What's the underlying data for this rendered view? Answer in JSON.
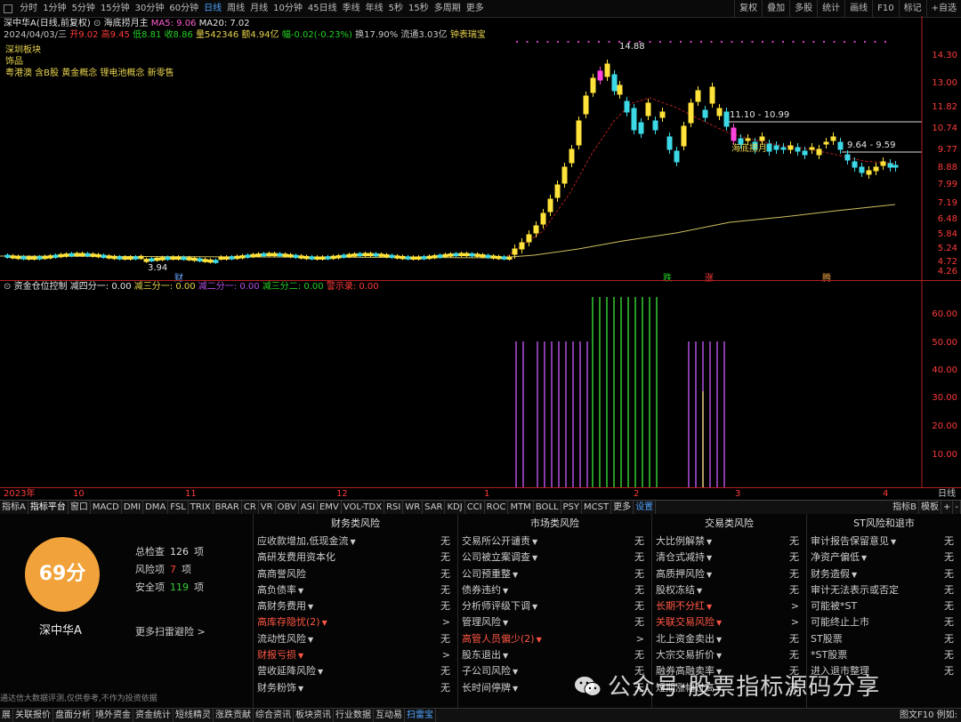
{
  "period_bar": {
    "items": [
      "分时",
      "1分钟",
      "5分钟",
      "15分钟",
      "30分钟",
      "60分钟",
      "日线",
      "周线",
      "月线",
      "10分钟",
      "45日线",
      "季线",
      "年线",
      "5秒",
      "15秒",
      "多周期",
      "更多"
    ],
    "active": "日线",
    "right_tools": [
      "复权",
      "叠加",
      "多股",
      "统计",
      "画线",
      "F10",
      "标记",
      "+自选"
    ]
  },
  "info_line": {
    "stock": "深中华A(日线,前复权)",
    "indicator": "海底捞月主",
    "ma5": "MA5: 9.06",
    "ma20": "MA20: 7.02"
  },
  "ohlc_line": {
    "date": "2024/04/03/三",
    "open": "开9.02",
    "high": "高9.45",
    "low": "低8.81",
    "close": "收8.86",
    "volume": "量542346",
    "amount": "额4.94亿",
    "change": "幅-0.02(-0.23%)",
    "turnover": "换17.90%",
    "float_cap": "流通3.03亿",
    "tool": "钟表瑞宝"
  },
  "tags": [
    "深圳板块",
    "饰品",
    "粤港澳 含B股 黄金概念 锂电池概念 新零售"
  ],
  "price_axis": [
    "14.30",
    "13.00",
    "11.82",
    "10.74",
    "9.77",
    "8.88",
    "7.99",
    "7.19",
    "6.48",
    "5.84",
    "5.24",
    "4.72",
    "4.26"
  ],
  "chart_labels": {
    "peak": "14.88",
    "low": "3.94",
    "range1": "11.10 - 10.99",
    "range2": "9.64 - 9.59",
    "pattern": "海底捞月",
    "markers": [
      "财",
      "跌",
      "涨",
      "腾"
    ]
  },
  "indicator_header": {
    "name": "资金仓位控制",
    "values": [
      "减四分一: 0.00",
      "减三分一: 0.00",
      "减二分一: 0.00",
      "减三分二: 0.00",
      "警示录: 0.00"
    ]
  },
  "ind_axis": [
    "60.00",
    "50.00",
    "40.00",
    "30.00",
    "20.00",
    "10.00"
  ],
  "date_axis": {
    "ticks": [
      "2023年",
      "10",
      "11",
      "12",
      "1",
      "2",
      "3",
      "4"
    ],
    "period": "日线"
  },
  "indicator_tabs": {
    "items": [
      "指标A",
      "指标平台",
      "窗口",
      "MACD",
      "DMI",
      "DMA",
      "FSL",
      "TRIX",
      "BRAR",
      "CR",
      "VR",
      "OBV",
      "ASI",
      "EMV",
      "VOL-TDX",
      "RSI",
      "WR",
      "SAR",
      "KDJ",
      "CCI",
      "ROC",
      "MTM",
      "BOLL",
      "PSY",
      "MCST",
      "更多",
      "设置"
    ],
    "right": [
      "指标B",
      "模板",
      "+",
      "-"
    ]
  },
  "scan": {
    "score": "69分",
    "stock_name": "深中华A",
    "summary": [
      {
        "label": "总检查",
        "value": "126",
        "unit": "项",
        "color": "#dddddd"
      },
      {
        "label": "风险项",
        "value": "7",
        "unit": "项",
        "color": "#ff4433"
      },
      {
        "label": "安全项",
        "value": "119",
        "unit": "项",
        "color": "#33cc33"
      }
    ],
    "more": "更多扫雷避险 >",
    "disclaimer": "通达信大数据评测,仅供参考,不作为投资依据",
    "columns": [
      {
        "title": "财务类风险",
        "rows": [
          {
            "label": "应收款增加,低现金流",
            "dd": true,
            "val": "无",
            "warn": false
          },
          {
            "label": "高研发费用资本化",
            "dd": false,
            "val": "无",
            "warn": false
          },
          {
            "label": "高商誉风险",
            "dd": false,
            "val": "无",
            "warn": false
          },
          {
            "label": "高负债率",
            "dd": true,
            "val": "无",
            "warn": false
          },
          {
            "label": "高财务费用",
            "dd": true,
            "val": "无",
            "warn": false
          },
          {
            "label": "高库存隐忧(2)",
            "dd": true,
            "val": ">",
            "warn": true
          },
          {
            "label": "流动性风险",
            "dd": true,
            "val": "无",
            "warn": false
          },
          {
            "label": "财报亏损",
            "dd": true,
            "val": ">",
            "warn": true
          },
          {
            "label": "营收延降风险",
            "dd": true,
            "val": "无",
            "warn": false
          },
          {
            "label": "财务粉饰",
            "dd": true,
            "val": "无",
            "warn": false
          }
        ]
      },
      {
        "title": "市场类风险",
        "rows": [
          {
            "label": "交易所公开谴责",
            "dd": true,
            "val": "无",
            "warn": false
          },
          {
            "label": "公司被立案调查",
            "dd": true,
            "val": "无",
            "warn": false
          },
          {
            "label": "公司预重整",
            "dd": true,
            "val": "无",
            "warn": false
          },
          {
            "label": "债券违约",
            "dd": true,
            "val": "无",
            "warn": false
          },
          {
            "label": "分析师评级下调",
            "dd": true,
            "val": "无",
            "warn": false
          },
          {
            "label": "管理风险",
            "dd": true,
            "val": "无",
            "warn": false
          },
          {
            "label": "高管人员偏少(2)",
            "dd": true,
            "val": ">",
            "warn": true
          },
          {
            "label": "股东退出",
            "dd": true,
            "val": "无",
            "warn": false
          },
          {
            "label": "子公司风险",
            "dd": true,
            "val": "无",
            "warn": false
          },
          {
            "label": "长时间停牌",
            "dd": true,
            "val": "无",
            "warn": false
          }
        ]
      },
      {
        "title": "交易类风险",
        "rows": [
          {
            "label": "大比例解禁",
            "dd": true,
            "val": "无",
            "warn": false
          },
          {
            "label": "清仓式减持",
            "dd": true,
            "val": "无",
            "warn": false
          },
          {
            "label": "高质押风险",
            "dd": true,
            "val": "无",
            "warn": false
          },
          {
            "label": "股权冻结",
            "dd": true,
            "val": "无",
            "warn": false
          },
          {
            "label": "长期不分红",
            "dd": true,
            "val": ">",
            "warn": true
          },
          {
            "label": "关联交易风险",
            "dd": true,
            "val": ">",
            "warn": true
          },
          {
            "label": "北上资金卖出",
            "dd": true,
            "val": "无",
            "warn": false
          },
          {
            "label": "大宗交易折价",
            "dd": true,
            "val": "无",
            "warn": false
          },
          {
            "label": "融券高融卖率",
            "dd": true,
            "val": "无",
            "warn": false
          },
          {
            "label": "短期涨幅过高",
            "dd": true,
            "val": "无",
            "warn": false
          }
        ]
      },
      {
        "title": "ST风险和退市",
        "rows": [
          {
            "label": "审计报告保留意见",
            "dd": true,
            "val": "无",
            "warn": false
          },
          {
            "label": "净资产偏低",
            "dd": true,
            "val": "无",
            "warn": false
          },
          {
            "label": "财务造假",
            "dd": true,
            "val": "无",
            "warn": false
          },
          {
            "label": "审计无法表示或否定",
            "dd": false,
            "val": "无",
            "warn": false
          },
          {
            "label": "可能被*ST",
            "dd": false,
            "val": "无",
            "warn": false
          },
          {
            "label": "可能终止上市",
            "dd": false,
            "val": "无",
            "warn": false
          },
          {
            "label": "ST股票",
            "dd": false,
            "val": "无",
            "warn": false
          },
          {
            "label": "*ST股票",
            "dd": false,
            "val": "无",
            "warn": false
          },
          {
            "label": "进入退市整理",
            "dd": false,
            "val": "无",
            "warn": false
          },
          {
            "label": "",
            "dd": false,
            "val": "",
            "warn": false
          }
        ]
      }
    ]
  },
  "status_bar": {
    "items": [
      "展",
      "关联报价",
      "盘面分析",
      "境外资金",
      "资金统计",
      "短线精灵",
      "涨跌贡献",
      "综合资讯",
      "板块资讯",
      "行业数据",
      "互动易",
      "扫雷宝"
    ],
    "right": "图文F10 例如:"
  },
  "watermark": "公众号·股票指标源码分享",
  "colors": {
    "up_candle": "#ffe23a",
    "down_candle": "#3dd8e6",
    "special_candle": "#ff44dd",
    "ma_line": "#b01f1f",
    "long_ma": "#d0c060",
    "ind_purple": "#b050e0",
    "ind_green": "#33cc33",
    "score_bg": "#f2a23a"
  }
}
